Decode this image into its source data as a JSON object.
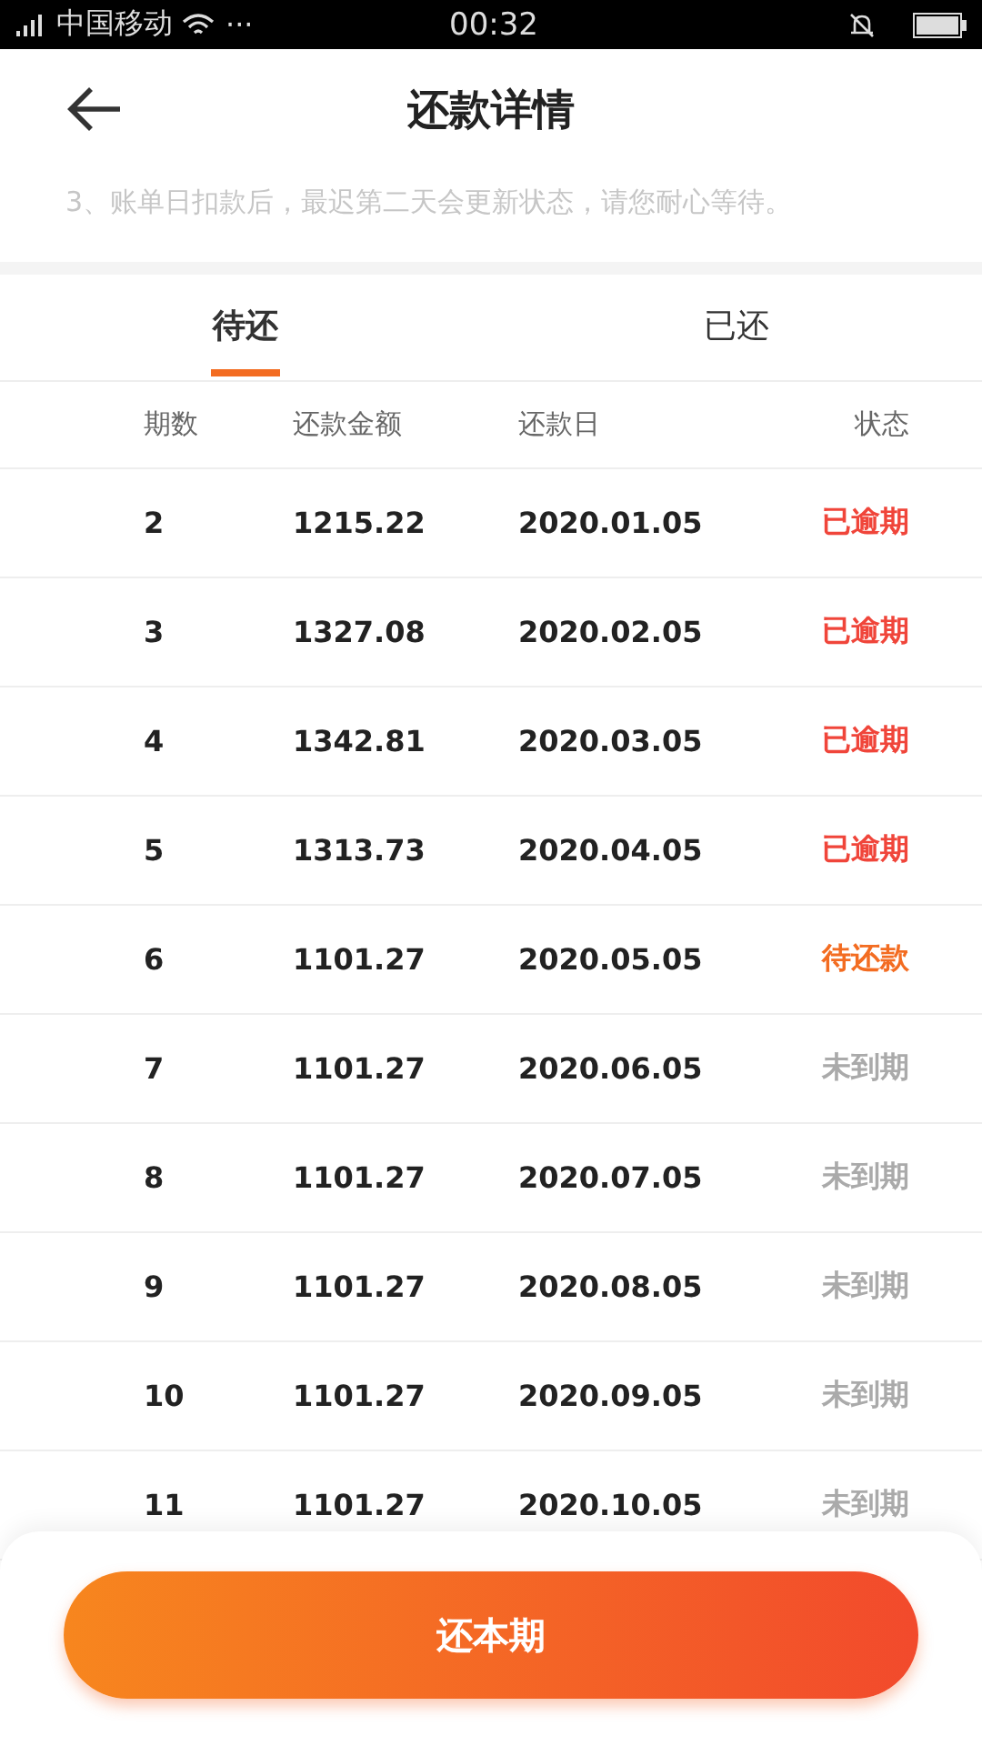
{
  "status_bar": {
    "carrier": "中国移动",
    "more": "···",
    "time": "00:32"
  },
  "header": {
    "title": "还款详情"
  },
  "notice": "3、账单日扣款后，最迟第二天会更新状态，请您耐心等待。",
  "tabs": [
    {
      "label": "待还",
      "selected": true
    },
    {
      "label": "已还",
      "selected": false
    }
  ],
  "table": {
    "columns": [
      "期数",
      "还款金额",
      "还款日",
      "状态"
    ],
    "rows": [
      {
        "period": "2",
        "amount": "1215.22",
        "date": "2020.01.05",
        "status": "已逾期",
        "kind": "overdue"
      },
      {
        "period": "3",
        "amount": "1327.08",
        "date": "2020.02.05",
        "status": "已逾期",
        "kind": "overdue"
      },
      {
        "period": "4",
        "amount": "1342.81",
        "date": "2020.03.05",
        "status": "已逾期",
        "kind": "overdue"
      },
      {
        "period": "5",
        "amount": "1313.73",
        "date": "2020.04.05",
        "status": "已逾期",
        "kind": "overdue"
      },
      {
        "period": "6",
        "amount": "1101.27",
        "date": "2020.05.05",
        "status": "待还款",
        "kind": "due"
      },
      {
        "period": "7",
        "amount": "1101.27",
        "date": "2020.06.05",
        "status": "未到期",
        "kind": "future"
      },
      {
        "period": "8",
        "amount": "1101.27",
        "date": "2020.07.05",
        "status": "未到期",
        "kind": "future"
      },
      {
        "period": "9",
        "amount": "1101.27",
        "date": "2020.08.05",
        "status": "未到期",
        "kind": "future"
      },
      {
        "period": "10",
        "amount": "1101.27",
        "date": "2020.09.05",
        "status": "未到期",
        "kind": "future"
      },
      {
        "period": "11",
        "amount": "1101.27",
        "date": "2020.10.05",
        "status": "未到期",
        "kind": "future"
      }
    ]
  },
  "pay_button": "还本期"
}
